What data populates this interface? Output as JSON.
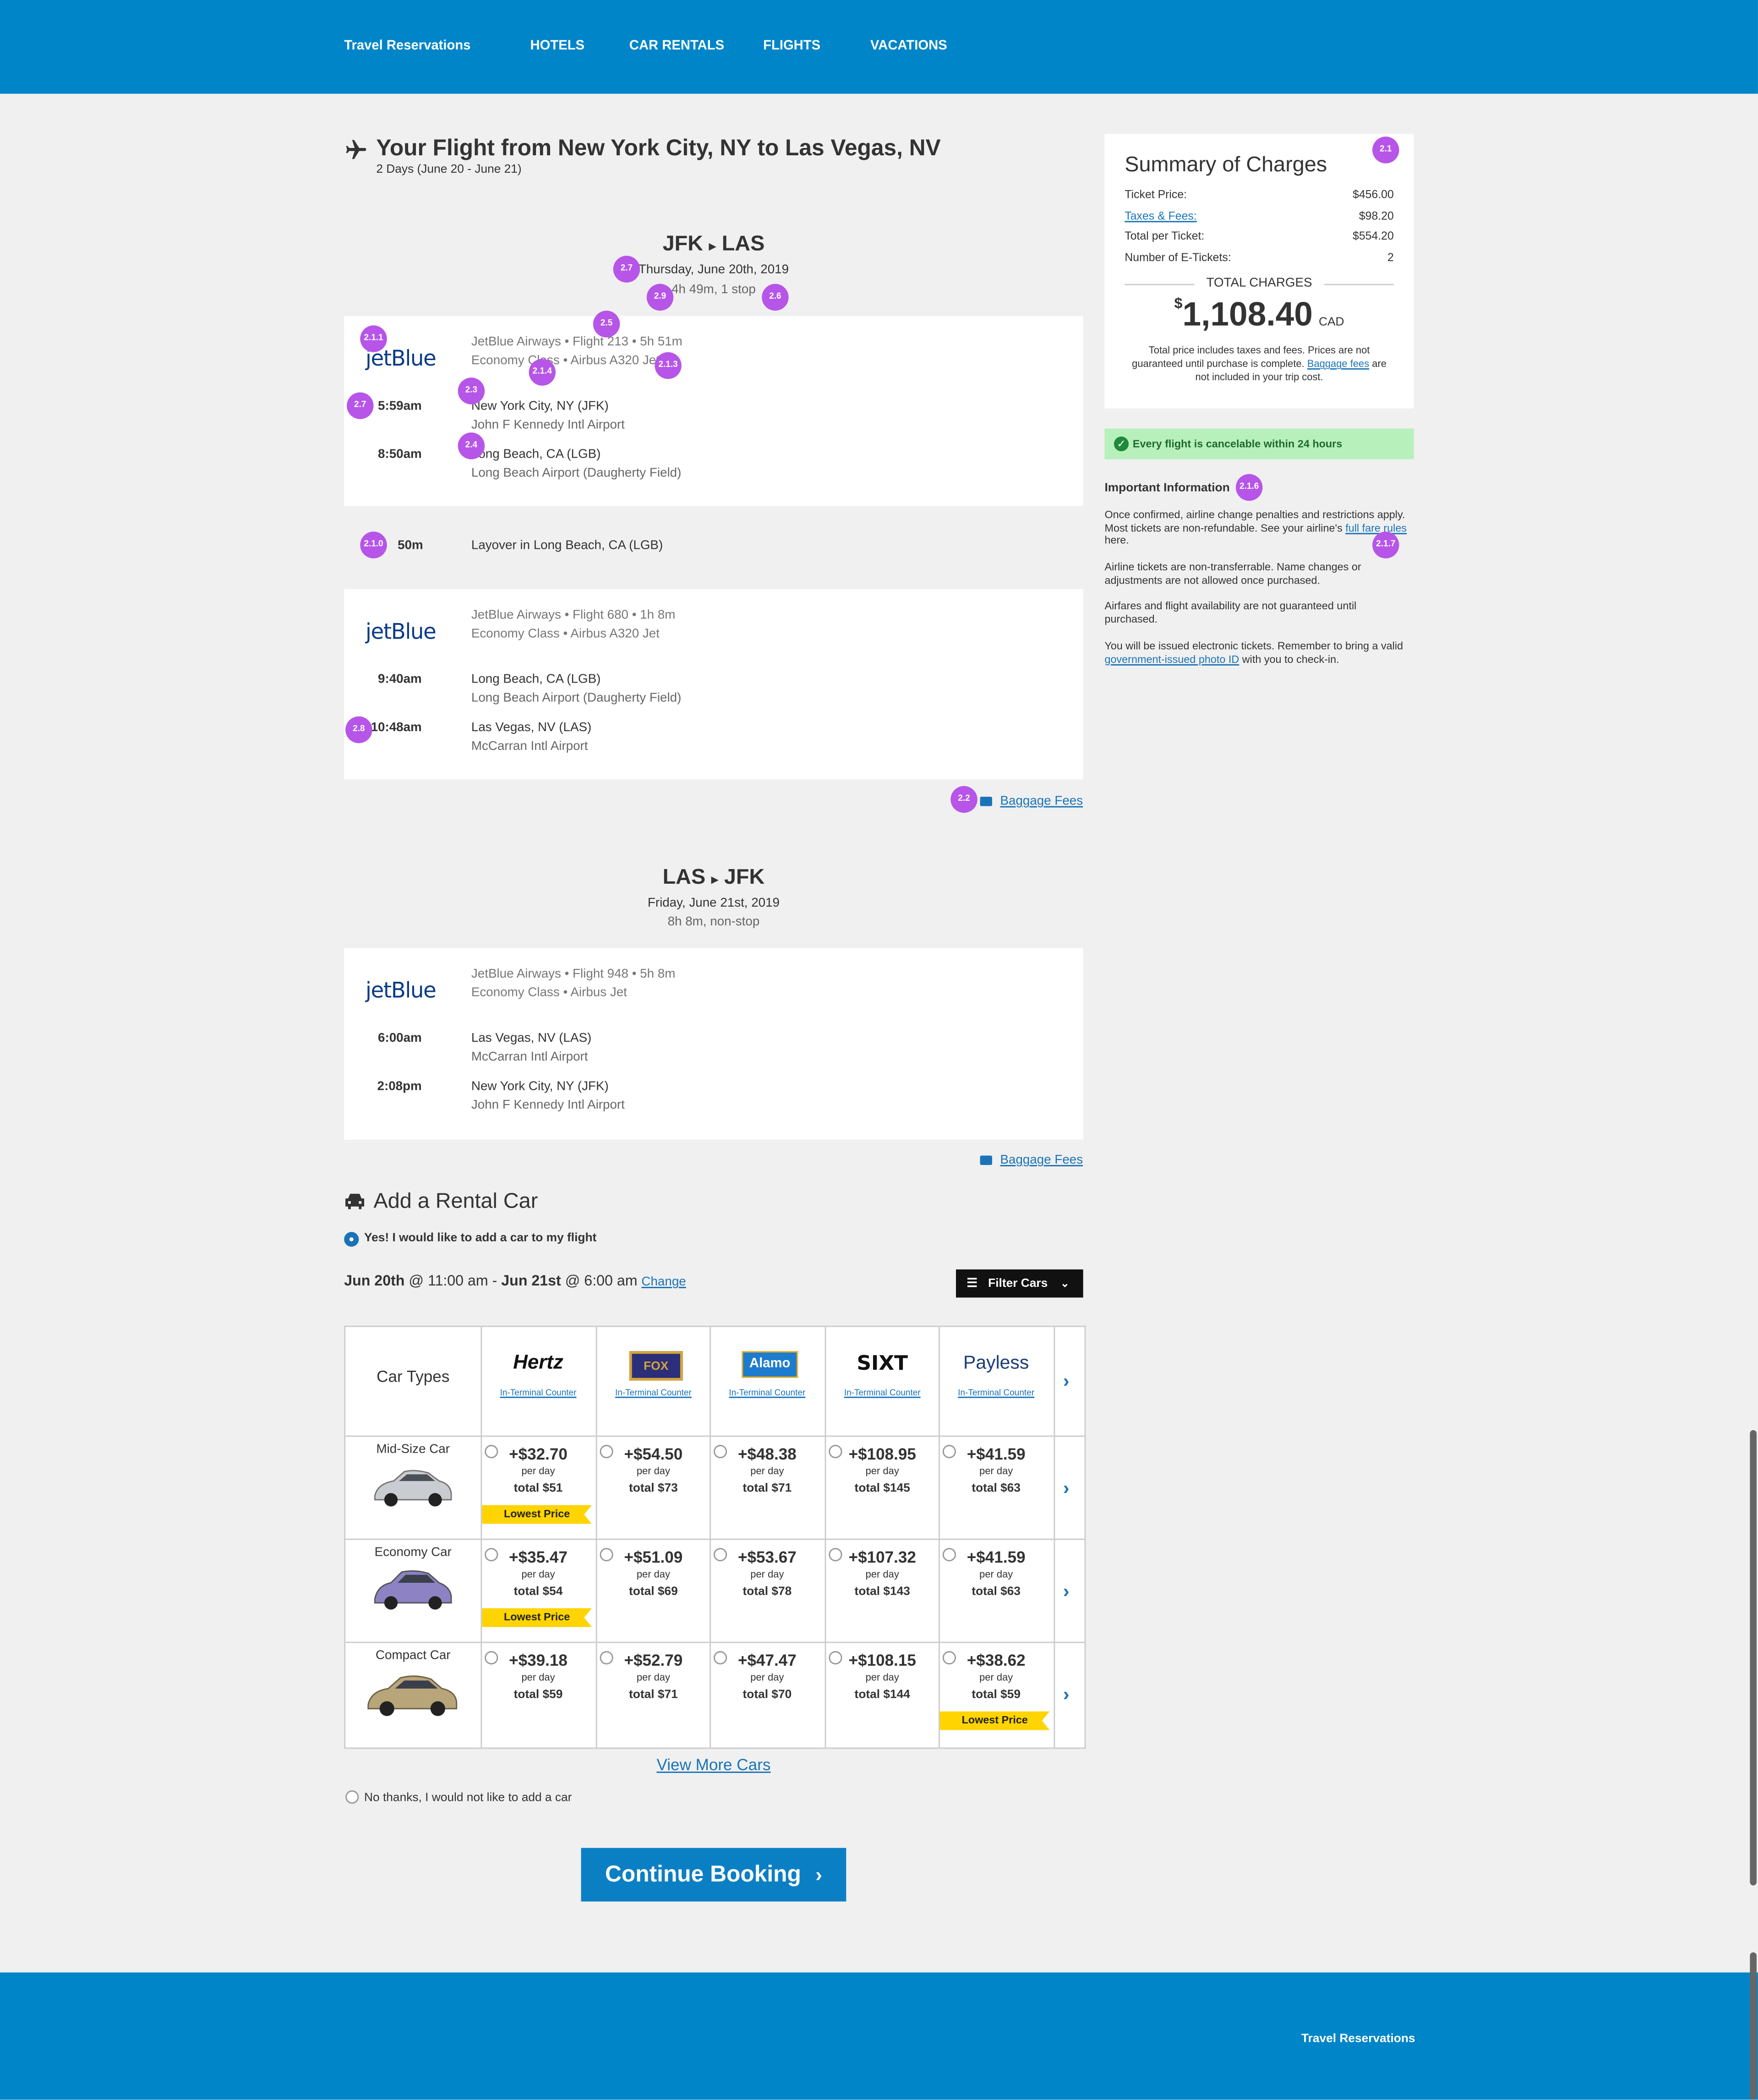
{
  "nav": {
    "brand": "Travel Reservations",
    "items": [
      "HOTELS",
      "CAR RENTALS",
      "FLIGHTS",
      "VACATIONS"
    ]
  },
  "page": {
    "title": "Your Flight from New York City, NY to Las Vegas, NV",
    "subtitle": "2 Days (June 20 - June 21)"
  },
  "outbound": {
    "route_from": "JFK",
    "route_to": "LAS",
    "date": "Thursday, June 20th, 2019",
    "duration": "4h 49m, 1 stop",
    "segments": [
      {
        "airline_logo": "jetBlue",
        "flight_info": "JetBlue Airways • Flight 213 • 5h 51m",
        "class_info": "Economy Class • Airbus A320 Jet",
        "depart_time": "5:59am",
        "depart_place": "New York City, NY (JFK)",
        "depart_airport": "John F Kennedy Intl Airport",
        "arrive_time": "8:50am",
        "arrive_place": "Long Beach, CA (LGB)",
        "arrive_airport": "Long Beach Airport (Daugherty Field)"
      },
      {
        "airline_logo": "jetBlue",
        "flight_info": "JetBlue Airways • Flight 680 • 1h 8m",
        "class_info": "Economy Class • Airbus A320 Jet",
        "depart_time": "9:40am",
        "depart_place": "Long Beach, CA (LGB)",
        "depart_airport": "Long Beach Airport (Daugherty Field)",
        "arrive_time": "10:48am",
        "arrive_place": "Las Vegas, NV (LAS)",
        "arrive_airport": "McCarran Intl Airport"
      }
    ],
    "layover_time": "50m",
    "layover_text": "Layover in Long Beach, CA (LGB)",
    "baggage_link": "Baggage Fees"
  },
  "return": {
    "route_from": "LAS",
    "route_to": "JFK",
    "date": "Friday, June 21st, 2019",
    "duration": "8h 8m, non-stop",
    "segment": {
      "airline_logo": "jetBlue",
      "flight_info": "JetBlue Airways • Flight 948 • 5h 8m",
      "class_info": "Economy Class • Airbus Jet",
      "depart_time": "6:00am",
      "depart_place": "Las Vegas, NV (LAS)",
      "depart_airport": "McCarran Intl Airport",
      "arrive_time": "2:08pm",
      "arrive_place": "New York City, NY (JFK)",
      "arrive_airport": "John F Kennedy Intl Airport"
    },
    "baggage_link": "Baggage Fees"
  },
  "markers": {
    "m21": "2.1",
    "m27a": "2.7",
    "m29": "2.9",
    "m26": "2.6",
    "m25": "2.5",
    "m211": "2.1.1",
    "m214": "2.1.4",
    "m213": "2.1.3",
    "m23": "2.3",
    "m27b": "2.7",
    "m24": "2.4",
    "m210": "2.1.0",
    "m28": "2.8",
    "m22": "2.2",
    "m216": "2.1.6",
    "m217": "2.1.7"
  },
  "summary": {
    "title": "Summary of Charges",
    "rows": [
      {
        "label": "Ticket Price:",
        "value": "$456.00"
      },
      {
        "label": "Taxes & Fees:",
        "value": "$98.20"
      },
      {
        "label": "Total per Ticket:",
        "value": "$554.20"
      },
      {
        "label": "Number of E-Tickets:",
        "value": "2"
      }
    ],
    "total_label": "TOTAL CHARGES",
    "currency_symbol": "$",
    "total_amount": "1,108.40",
    "currency": "CAD",
    "note_1": "Total price includes taxes and fees. Prices are not",
    "note_2_pre": "guaranteed until purchase is complete.",
    "note_2_link": "Baggage fees",
    "note_2_post": "are",
    "note_3": "not included in your trip cost."
  },
  "notice": {
    "text": "Every flight is cancelable within 24 hours",
    "icon": "check-circle-icon"
  },
  "important": {
    "heading": "Important Information",
    "p1_line1": "Once confirmed, airline change penalties and restrictions apply.",
    "p1_line2_pre": "Most tickets are non-refundable. See your airline's",
    "p1_link": "full fare rules",
    "p1_post": "here.",
    "p2": "Airline tickets are non-transferrable. Name changes or adjustments are not allowed once purchased.",
    "p3": "Airfares and flight availability are not guaranteed until purchased.",
    "p4_pre": "You will be issued electronic tickets. Remember to bring a valid",
    "p4_link": "government-issued photo ID",
    "p4_post": "with you to check-in."
  },
  "rental": {
    "heading": "Add a Rental Car",
    "yes_option": "Yes! I would like to add a car to my flight",
    "dates_from_date": "Jun 20th",
    "dates_from_time": "@ 11:00 am",
    "dates_sep": "-",
    "dates_to_date": "Jun 21st",
    "dates_to_time": "@ 6:00 am",
    "change_link": "Change",
    "filter_label": "Filter Cars",
    "col_header": "Car Types",
    "vendors": [
      {
        "name": "Hertz",
        "counter": "In-Terminal Counter"
      },
      {
        "name": "FOX",
        "counter": "In-Terminal Counter"
      },
      {
        "name": "Alamo",
        "counter": "In-Terminal Counter"
      },
      {
        "name": "SIXT",
        "counter": "In-Terminal Counter"
      },
      {
        "name": "Payless",
        "counter": "In-Terminal Counter"
      }
    ],
    "cars": [
      {
        "type": "Mid-Size Car",
        "prices": [
          "+$32.70",
          "+$54.50",
          "+$48.38",
          "+$108.95",
          "+$41.59"
        ],
        "totals": [
          "total $51",
          "total $73",
          "total $71",
          "total $145",
          "total $63"
        ],
        "lowest_index": 0
      },
      {
        "type": "Economy Car",
        "prices": [
          "+$35.47",
          "+$51.09",
          "+$53.67",
          "+$107.32",
          "+$41.59"
        ],
        "totals": [
          "total $54",
          "total $69",
          "total $78",
          "total $143",
          "total $63"
        ],
        "lowest_index": 0
      },
      {
        "type": "Compact Car",
        "prices": [
          "+$39.18",
          "+$52.79",
          "+$47.47",
          "+$108.15",
          "+$38.62"
        ],
        "totals": [
          "total $59",
          "total $71",
          "total $70",
          "total $144",
          "total $59"
        ],
        "lowest_index": 4
      }
    ],
    "per_day": "per day",
    "lowest_label": "Lowest Price",
    "view_more": "View More Cars",
    "no_option": "No thanks, I would not like to add a car"
  },
  "continue_label": "Continue Booking",
  "footer": {
    "brand": "Travel Reservations"
  },
  "colors": {
    "brand_blue": "#0085c8",
    "marker_purple": "#b655e8",
    "lowest_yellow": "#ffd400",
    "notice_green": "#b8f0bc"
  }
}
